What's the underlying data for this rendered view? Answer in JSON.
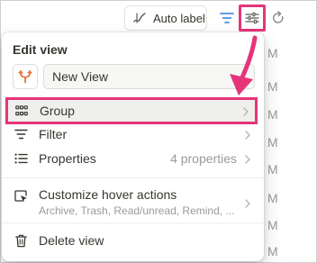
{
  "toolbar": {
    "auto_label": "Auto label",
    "icons": [
      "pen-wave-icon",
      "filter-lines-icon",
      "settings-sliders-icon",
      "refresh-icon"
    ]
  },
  "background": {
    "list_letters": [
      "M",
      "M",
      "M",
      "M",
      "M",
      "M",
      "M",
      "M"
    ]
  },
  "menu": {
    "title": "Edit view",
    "view_name": "New View",
    "items": [
      {
        "label": "Group",
        "icon": "group-grid-icon"
      },
      {
        "label": "Filter",
        "icon": "filter-icon"
      },
      {
        "label": "Properties",
        "value": "4 properties",
        "icon": "list-icon"
      },
      {
        "label": "Customize hover actions",
        "sub": "Archive, Trash, Read/unread, Remind, ...",
        "icon": "cursor-box-icon"
      },
      {
        "label": "Delete view",
        "icon": "trash-icon"
      }
    ]
  },
  "colors": {
    "highlight": "#e6347a",
    "view_icon": "#e8743b",
    "accent_blue": "#2e7bd8"
  }
}
